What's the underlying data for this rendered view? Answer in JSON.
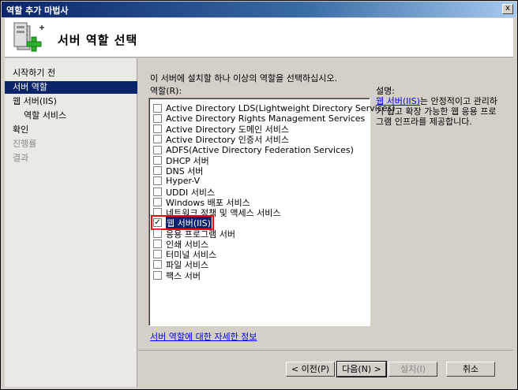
{
  "window": {
    "title": "역할 추가 마법사",
    "close_glyph": "x"
  },
  "header": {
    "title": "서버 역할 선택",
    "icon": "server-role-add-icon"
  },
  "nav": [
    {
      "label": "시작하기 전",
      "state": "normal"
    },
    {
      "label": "서버 역할",
      "state": "active"
    },
    {
      "label": "웹 서버(IIS)",
      "state": "normal"
    },
    {
      "label": "역할 서비스",
      "state": "indent"
    },
    {
      "label": "확인",
      "state": "normal"
    },
    {
      "label": "진행률",
      "state": "disabled"
    },
    {
      "label": "결과",
      "state": "disabled"
    }
  ],
  "main": {
    "instruction": "이 서버에 설치할 하나 이상의 역할을 선택하십시오.",
    "roles_label": "역할(R):",
    "roles": [
      {
        "label": "Active Directory LDS(Lightweight Directory Services)",
        "checked": false
      },
      {
        "label": "Active Directory Rights Management Services",
        "checked": false
      },
      {
        "label": "Active Directory 도메인 서비스",
        "checked": false
      },
      {
        "label": "Active Directory 인증서 서비스",
        "checked": false
      },
      {
        "label": "ADFS(Active Directory Federation Services)",
        "checked": false
      },
      {
        "label": "DHCP 서버",
        "checked": false
      },
      {
        "label": "DNS 서버",
        "checked": false
      },
      {
        "label": "Hyper-V",
        "checked": false
      },
      {
        "label": "UDDI 서비스",
        "checked": false
      },
      {
        "label": "Windows 배포 서비스",
        "checked": false
      },
      {
        "label": "네트워크 정책 및 액세스 서비스",
        "checked": false
      },
      {
        "label": "웹 서버(IIS)",
        "checked": true
      },
      {
        "label": "응용 프로그램 서버",
        "checked": false
      },
      {
        "label": "인쇄 서비스",
        "checked": false
      },
      {
        "label": "터미널 서비스",
        "checked": false
      },
      {
        "label": "파일 서비스",
        "checked": false
      },
      {
        "label": "팩스 서버",
        "checked": false
      }
    ],
    "description_label": "설명:",
    "description_link": "웹 서버(IIS)",
    "description_text": "는 안정적이고 관리하기 쉽고 확장 가능한 웹 응용 프로그램 인프라를 제공합니다.",
    "more_info_link": "서버 역할에 대한 자세한 정보"
  },
  "buttons": {
    "prev": "< 이전(P)",
    "next": "다음(N) >",
    "install": "설치(I)",
    "cancel": "취소"
  },
  "check_glyph": "✓"
}
